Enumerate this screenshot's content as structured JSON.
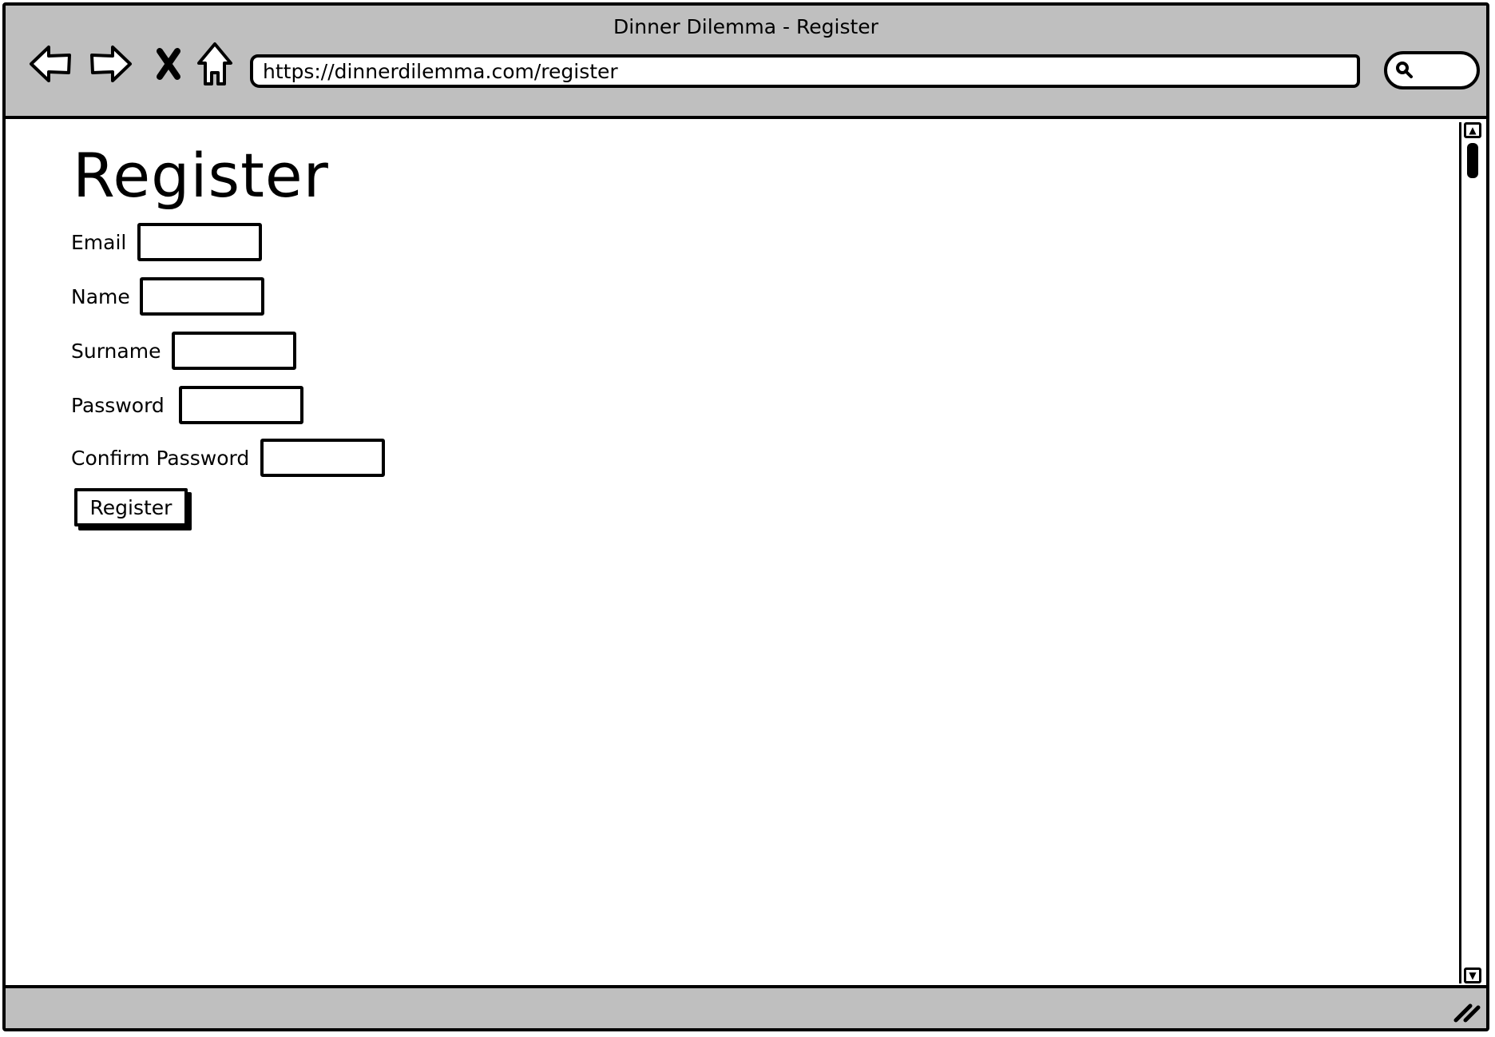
{
  "window": {
    "title": "Dinner Dilemma - Register"
  },
  "toolbar": {
    "buttons": [
      {
        "name": "back",
        "icon": "arrow-left-icon"
      },
      {
        "name": "forward",
        "icon": "arrow-right-icon"
      },
      {
        "name": "stop",
        "icon": "close-icon"
      },
      {
        "name": "home",
        "icon": "home-icon"
      }
    ],
    "url": "https://dinnerdilemma.com/register",
    "search_icon": "search-icon"
  },
  "page": {
    "title": "Register",
    "fields": [
      {
        "label": "Email",
        "value": ""
      },
      {
        "label": "Name",
        "value": ""
      },
      {
        "label": "Surname",
        "value": ""
      },
      {
        "label": "Password",
        "value": ""
      },
      {
        "label": "Confirm Password",
        "value": ""
      }
    ],
    "submit_label": "Register"
  },
  "colors": {
    "chrome": "#bfbfbf",
    "ink": "#000000",
    "background": "#ffffff"
  }
}
